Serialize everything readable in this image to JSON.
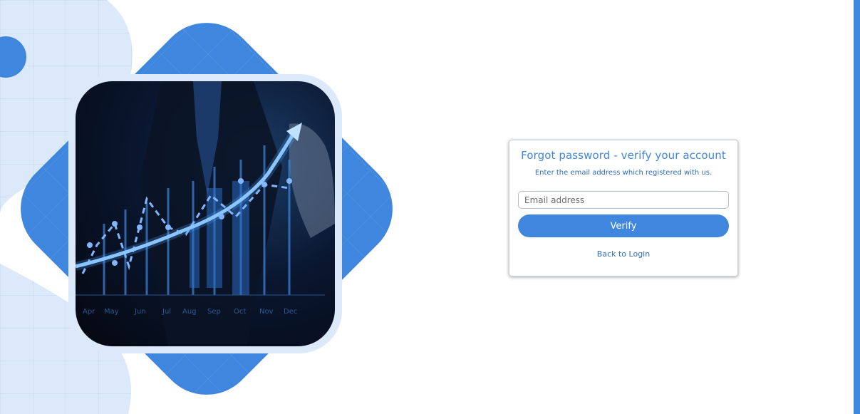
{
  "forgot_form": {
    "title": "Forgot password - verify your account",
    "subtitle": "Enter the email address which registered with us.",
    "email_placeholder": "Email address",
    "email_value": "",
    "verify_label": "Verify",
    "back_link_label": "Back to Login"
  },
  "illustration": {
    "months": [
      "Apr",
      "May",
      "Jun",
      "Jul",
      "Aug",
      "Sep",
      "Oct",
      "Nov",
      "Dec"
    ]
  },
  "colors": {
    "accent": "#3f87de",
    "light_accent": "#dbe9fb",
    "text_link": "#2d6dbd"
  }
}
